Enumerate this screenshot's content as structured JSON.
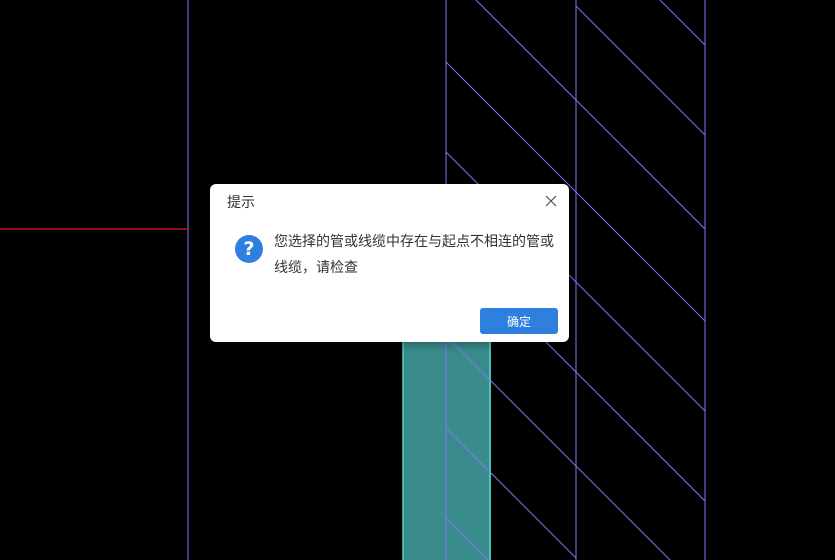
{
  "dialog": {
    "title": "提示",
    "message": "您选择的管或线缆中存在与起点不相连的管或线缆，请检查",
    "ok_label": "确定",
    "icon": "question-icon",
    "close_icon": "close-icon"
  },
  "colors": {
    "background": "#000000",
    "cad_line": "#7b78f5",
    "red_line": "#c0121c",
    "pipe_fill": "#3a8c8c",
    "pipe_edge": "#4fd4c4",
    "accent": "#2f7fde"
  }
}
